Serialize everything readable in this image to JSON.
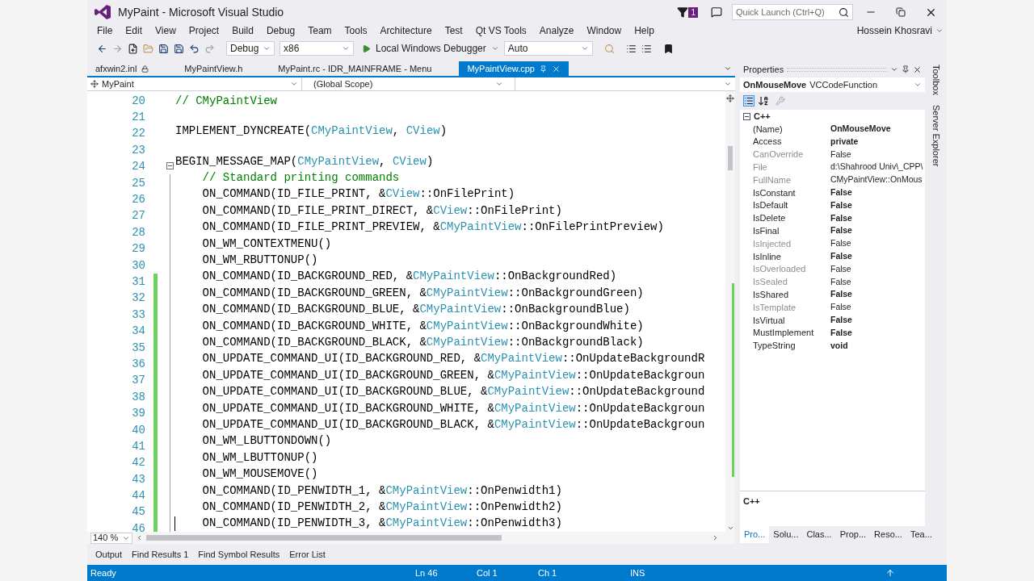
{
  "window": {
    "title": "MyPaint - Microsoft Visual Studio",
    "notification_count": "1",
    "quick_launch": {
      "placeholder": "Quick Launch (Ctrl+Q)"
    },
    "user": "Hossein Khosravi"
  },
  "menu": [
    "File",
    "Edit",
    "View",
    "Project",
    "Build",
    "Debug",
    "Team",
    "Tools",
    "Architecture",
    "Test",
    "Qt VS Tools",
    "Analyze",
    "Window",
    "Help"
  ],
  "toolbar": {
    "configuration": "Debug",
    "platform": "x86",
    "debugger": "Local Windows Debugger",
    "solution_config": "Auto"
  },
  "tabs": [
    {
      "label": "afxwin2.inl",
      "selected": false,
      "locked": true
    },
    {
      "label": "MyPaintView.h",
      "selected": false,
      "locked": false
    },
    {
      "label": "MyPaint.rc - IDR_MAINFRAME - Menu",
      "selected": false,
      "locked": false
    },
    {
      "label": "MyPaintView.cpp",
      "selected": true,
      "locked": false
    }
  ],
  "nav_bar": {
    "project": "MyPaint",
    "scope": "(Global Scope)"
  },
  "editor": {
    "zoom": "140 %",
    "lines": [
      {
        "n": "20",
        "changed": false,
        "cursor": false,
        "tokens": [
          {
            "t": "// CMyPaintView",
            "kind": "comment"
          }
        ]
      },
      {
        "n": "21",
        "changed": false,
        "cursor": false
      },
      {
        "n": "22",
        "changed": false,
        "cursor": false,
        "tokens": [
          {
            "t": "IMPLEMENT_DYNCREATE(",
            "kind": "plain"
          },
          {
            "t": "CMyPaintView",
            "kind": "type"
          },
          {
            "t": ", ",
            "kind": "plain"
          },
          {
            "t": "CView",
            "kind": "type"
          },
          {
            "t": ")",
            "kind": "plain"
          }
        ]
      },
      {
        "n": "23",
        "changed": false,
        "cursor": false
      },
      {
        "n": "24",
        "changed": false,
        "cursor": false,
        "fold": {
          "expanded": true
        },
        "tokens": [
          {
            "t": "BEGIN_MESSAGE_MAP(",
            "kind": "plain"
          },
          {
            "t": "CMyPaintView",
            "kind": "type"
          },
          {
            "t": ", ",
            "kind": "plain"
          },
          {
            "t": "CView",
            "kind": "type"
          },
          {
            "t": ")",
            "kind": "plain"
          }
        ]
      },
      {
        "n": "25",
        "changed": false,
        "cursor": false,
        "tokens": [
          {
            "t": "    // Standard printing commands",
            "kind": "comment"
          }
        ]
      },
      {
        "n": "26",
        "changed": false,
        "cursor": false,
        "tokens": [
          {
            "t": "    ON_COMMAND(ID_FILE_PRINT, &",
            "kind": "plain"
          },
          {
            "t": "CView",
            "kind": "type"
          },
          {
            "t": "::OnFilePrint)",
            "kind": "plain"
          }
        ]
      },
      {
        "n": "27",
        "changed": false,
        "cursor": false,
        "tokens": [
          {
            "t": "    ON_COMMAND(ID_FILE_PRINT_DIRECT, &",
            "kind": "plain"
          },
          {
            "t": "CView",
            "kind": "type"
          },
          {
            "t": "::OnFilePrint)",
            "kind": "plain"
          }
        ]
      },
      {
        "n": "28",
        "changed": false,
        "cursor": false,
        "tokens": [
          {
            "t": "    ON_COMMAND(ID_FILE_PRINT_PREVIEW, &",
            "kind": "plain"
          },
          {
            "t": "CMyPaintView",
            "kind": "type"
          },
          {
            "t": "::OnFilePrintPreview)",
            "kind": "plain"
          }
        ]
      },
      {
        "n": "29",
        "changed": false,
        "cursor": false,
        "tokens": [
          {
            "t": "    ON_WM_CONTEXTMENU()",
            "kind": "plain"
          }
        ]
      },
      {
        "n": "30",
        "changed": false,
        "cursor": false,
        "tokens": [
          {
            "t": "    ON_WM_RBUTTONUP()",
            "kind": "plain"
          }
        ]
      },
      {
        "n": "31",
        "changed": true,
        "cursor": false,
        "tokens": [
          {
            "t": "    ON_COMMAND(ID_BACKGROUND_RED, &",
            "kind": "plain"
          },
          {
            "t": "CMyPaintView",
            "kind": "type"
          },
          {
            "t": "::OnBackgroundRed)",
            "kind": "plain"
          }
        ]
      },
      {
        "n": "32",
        "changed": true,
        "cursor": false,
        "tokens": [
          {
            "t": "    ON_COMMAND(ID_BACKGROUND_GREEN, &",
            "kind": "plain"
          },
          {
            "t": "CMyPaintView",
            "kind": "type"
          },
          {
            "t": "::OnBackgroundGreen)",
            "kind": "plain"
          }
        ]
      },
      {
        "n": "33",
        "changed": true,
        "cursor": false,
        "tokens": [
          {
            "t": "    ON_COMMAND(ID_BACKGROUND_BLUE, &",
            "kind": "plain"
          },
          {
            "t": "CMyPaintView",
            "kind": "type"
          },
          {
            "t": "::OnBackgroundBlue)",
            "kind": "plain"
          }
        ]
      },
      {
        "n": "34",
        "changed": true,
        "cursor": false,
        "tokens": [
          {
            "t": "    ON_COMMAND(ID_BACKGROUND_WHITE, &",
            "kind": "plain"
          },
          {
            "t": "CMyPaintView",
            "kind": "type"
          },
          {
            "t": "::OnBackgroundWhite)",
            "kind": "plain"
          }
        ]
      },
      {
        "n": "35",
        "changed": true,
        "cursor": false,
        "tokens": [
          {
            "t": "    ON_COMMAND(ID_BACKGROUND_BLACK, &",
            "kind": "plain"
          },
          {
            "t": "CMyPaintView",
            "kind": "type"
          },
          {
            "t": "::OnBackgroundBlack)",
            "kind": "plain"
          }
        ]
      },
      {
        "n": "36",
        "changed": true,
        "cursor": false,
        "tokens": [
          {
            "t": "    ON_UPDATE_COMMAND_UI(ID_BACKGROUND_RED, &",
            "kind": "plain"
          },
          {
            "t": "CMyPaintView",
            "kind": "type"
          },
          {
            "t": "::OnUpdateBackgroundR",
            "kind": "plain"
          }
        ]
      },
      {
        "n": "37",
        "changed": true,
        "cursor": false,
        "tokens": [
          {
            "t": "    ON_UPDATE_COMMAND_UI(ID_BACKGROUND_GREEN, &",
            "kind": "plain"
          },
          {
            "t": "CMyPaintView",
            "kind": "type"
          },
          {
            "t": "::OnUpdateBackgroun",
            "kind": "plain"
          }
        ]
      },
      {
        "n": "38",
        "changed": true,
        "cursor": false,
        "tokens": [
          {
            "t": "    ON_UPDATE_COMMAND_UI(ID_BACKGROUND_BLUE, &",
            "kind": "plain"
          },
          {
            "t": "CMyPaintView",
            "kind": "type"
          },
          {
            "t": "::OnUpdateBackground",
            "kind": "plain"
          }
        ]
      },
      {
        "n": "39",
        "changed": true,
        "cursor": false,
        "tokens": [
          {
            "t": "    ON_UPDATE_COMMAND_UI(ID_BACKGROUND_WHITE, &",
            "kind": "plain"
          },
          {
            "t": "CMyPaintView",
            "kind": "type"
          },
          {
            "t": "::OnUpdateBackgroun",
            "kind": "plain"
          }
        ]
      },
      {
        "n": "40",
        "changed": true,
        "cursor": false,
        "tokens": [
          {
            "t": "    ON_UPDATE_COMMAND_UI(ID_BACKGROUND_BLACK, &",
            "kind": "plain"
          },
          {
            "t": "CMyPaintView",
            "kind": "type"
          },
          {
            "t": "::OnUpdateBackgroun",
            "kind": "plain"
          }
        ]
      },
      {
        "n": "41",
        "changed": true,
        "cursor": false,
        "tokens": [
          {
            "t": "    ON_WM_LBUTTONDOWN()",
            "kind": "plain"
          }
        ]
      },
      {
        "n": "42",
        "changed": true,
        "cursor": false,
        "tokens": [
          {
            "t": "    ON_WM_LBUTTONUP()",
            "kind": "plain"
          }
        ]
      },
      {
        "n": "43",
        "changed": true,
        "cursor": false,
        "tokens": [
          {
            "t": "    ON_WM_MOUSEMOVE()",
            "kind": "plain"
          }
        ]
      },
      {
        "n": "44",
        "changed": true,
        "cursor": false,
        "tokens": [
          {
            "t": "    ON_COMMAND(ID_PENWIDTH_1, &",
            "kind": "plain"
          },
          {
            "t": "CMyPaintView",
            "kind": "type"
          },
          {
            "t": "::OnPenwidth1)",
            "kind": "plain"
          }
        ]
      },
      {
        "n": "45",
        "changed": true,
        "cursor": false,
        "tokens": [
          {
            "t": "    ON_COMMAND(ID_PENWIDTH_2, &",
            "kind": "plain"
          },
          {
            "t": "CMyPaintView",
            "kind": "type"
          },
          {
            "t": "::OnPenwidth2)",
            "kind": "plain"
          }
        ]
      },
      {
        "n": "46",
        "changed": true,
        "cursor": true,
        "tokens": [
          {
            "t": "    ON_COMMAND(ID_PENWIDTH_3, &",
            "kind": "plain"
          },
          {
            "t": "CMyPaintView",
            "kind": "type"
          },
          {
            "t": "::OnPenwidth3)",
            "kind": "plain"
          }
        ]
      }
    ]
  },
  "properties": {
    "title": "Properties",
    "object_name": "OnMouseMove",
    "object_type": "VCCodeFunction",
    "category": {
      "label": "C++",
      "expanded": true
    },
    "rows": [
      {
        "name": "(Name)",
        "value": "OnMouseMove",
        "readonly": false
      },
      {
        "name": "Access",
        "value": "private",
        "readonly": false
      },
      {
        "name": "CanOverride",
        "value": "False",
        "readonly": true
      },
      {
        "name": "File",
        "value": "d:\\Shahrood Univ\\_CPP\\",
        "readonly": true
      },
      {
        "name": "FullName",
        "value": "CMyPaintView::OnMous",
        "readonly": true
      },
      {
        "name": "IsConstant",
        "value": "False",
        "readonly": false
      },
      {
        "name": "IsDefault",
        "value": "False",
        "readonly": false
      },
      {
        "name": "IsDelete",
        "value": "False",
        "readonly": false
      },
      {
        "name": "IsFinal",
        "value": "False",
        "readonly": false
      },
      {
        "name": "IsInjected",
        "value": "False",
        "readonly": true
      },
      {
        "name": "IsInline",
        "value": "False",
        "readonly": false
      },
      {
        "name": "IsOverloaded",
        "value": "False",
        "readonly": true
      },
      {
        "name": "IsSealed",
        "value": "False",
        "readonly": true
      },
      {
        "name": "IsShared",
        "value": "False",
        "readonly": false
      },
      {
        "name": "IsTemplate",
        "value": "False",
        "readonly": true
      },
      {
        "name": "IsVirtual",
        "value": "False",
        "readonly": false
      },
      {
        "name": "MustImplement",
        "value": "False",
        "readonly": false
      },
      {
        "name": "TypeString",
        "value": "void",
        "readonly": false
      }
    ],
    "description": "C++",
    "bottom_tabs": [
      {
        "label": "Pro...",
        "selected": true
      },
      {
        "label": "Solu...",
        "selected": false
      },
      {
        "label": "Clas...",
        "selected": false
      },
      {
        "label": "Prop...",
        "selected": false
      },
      {
        "label": "Reso...",
        "selected": false
      },
      {
        "label": "Tea...",
        "selected": false
      }
    ]
  },
  "side_tabs": [
    "Toolbox",
    "Server Explorer"
  ],
  "output_tabs": [
    "Output",
    "Find Results 1",
    "Find Symbol Results",
    "Error List"
  ],
  "status_bar": {
    "state": "Ready",
    "line": "Ln 46",
    "col": "Col 1",
    "ch": "Ch 1",
    "mode": "INS"
  }
}
